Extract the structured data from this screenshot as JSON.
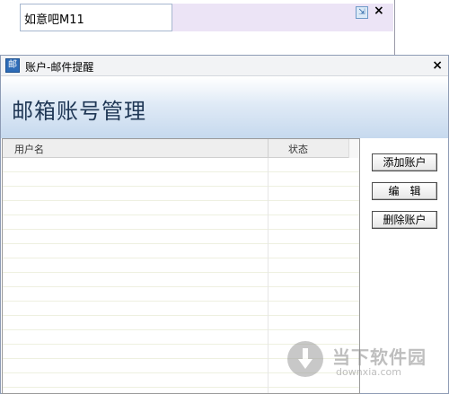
{
  "toolbar_window": {
    "input_value": "如意吧M11",
    "tool_icon": "expand-icon",
    "close_label": "×"
  },
  "dialog": {
    "app_icon_char": "邮",
    "title": "账户-邮件提醒",
    "close_label": "×",
    "header_title": "邮箱账号管理"
  },
  "table": {
    "columns": [
      "用户名",
      "状态"
    ],
    "rows": []
  },
  "buttons": {
    "add": "添加账户",
    "edit": "编　辑",
    "delete": "删除账户"
  },
  "watermark": {
    "text_cn": "当下软件园",
    "text_en": "downxia.com"
  },
  "colors": {
    "header_gradient_end": "#c6d9ee",
    "accent": "#2f6db8",
    "toolbar_strip": "#ece4f6"
  }
}
